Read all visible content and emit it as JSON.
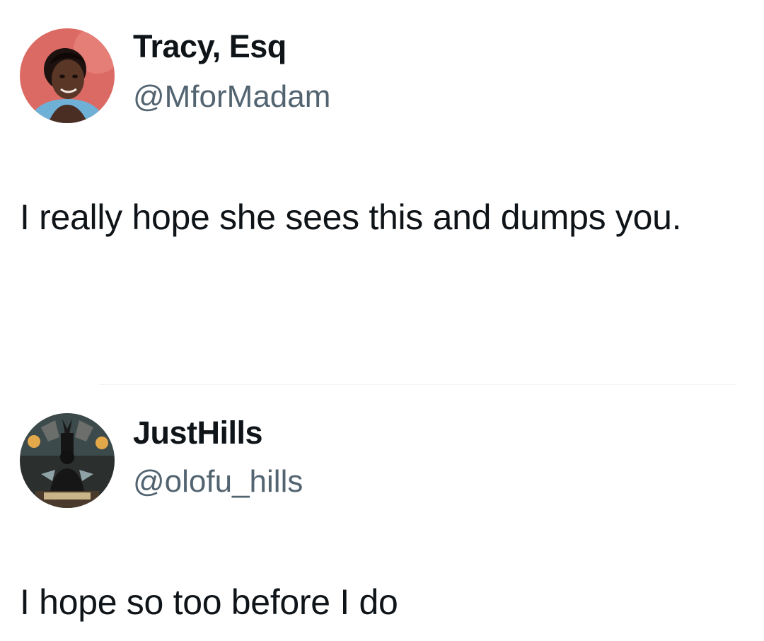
{
  "tweets": [
    {
      "display_name": "Tracy, Esq",
      "handle": "@MforMadam",
      "text": "I really hope she sees this and dumps you.",
      "avatar_icon": "profile-photo"
    },
    {
      "display_name": "JustHills",
      "handle": "@olofu_hills",
      "text": "I hope so too before I do",
      "avatar_icon": "profile-artwork"
    }
  ],
  "colors": {
    "text": "#0f1419",
    "handle": "#536471",
    "background": "#ffffff"
  }
}
